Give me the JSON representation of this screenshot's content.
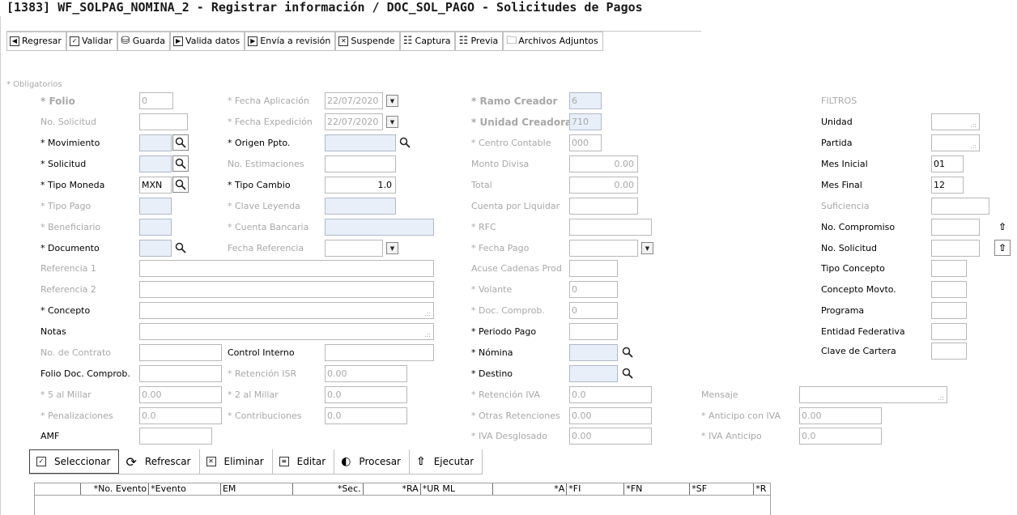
{
  "window": {
    "title": "[1383]  WF_SOLPAG_NOMINA_2 - Registrar información / DOC_SOL_PAGO - Solicitudes de Pagos"
  },
  "toolbar": {
    "items": [
      {
        "label": "Regresar",
        "icon": "back-icon"
      },
      {
        "label": "Validar",
        "icon": "check-icon"
      },
      {
        "label": "Guarda",
        "icon": "save-icon"
      },
      {
        "label": "Valida datos",
        "icon": "play-icon"
      },
      {
        "label": "Envía a revisión",
        "icon": "play-icon"
      },
      {
        "label": "Suspende",
        "icon": "close-icon"
      },
      {
        "label": "Captura",
        "icon": "capture-icon"
      },
      {
        "label": "Previa",
        "icon": "preview-icon"
      },
      {
        "label": "Archivos Adjuntos",
        "icon": "folder-icon"
      }
    ]
  },
  "form": {
    "obligatorios": "* Obligatorios",
    "folio_label": "* Folio",
    "folio_value": "0",
    "no_solicitud_label": "No. Solicitud",
    "movimiento_label": "* Movimiento",
    "solicitud_label": "* Solicitud",
    "tipo_moneda_label": "* Tipo Moneda",
    "tipo_moneda_value": "MXN",
    "tipo_pago_label": "* Tipo Pago",
    "beneficiario_label": "* Beneficiario",
    "documento_label": "* Documento",
    "referencia1_label": "Referencia 1",
    "referencia2_label": "Referencia 2",
    "concepto_label": "* Concepto",
    "notas_label": "Notas",
    "no_contrato_label": "No. de Contrato",
    "folio_doc_label": "Folio Doc. Comprob.",
    "cinco_millar_label": "* 5 al Millar",
    "cinco_millar_value": "0.00",
    "penalizaciones_label": "* Penalizaciones",
    "penalizaciones_value": "0.0",
    "amf_label": "AMF",
    "fecha_aplicacion_label": "* Fecha Aplicación",
    "fecha_aplicacion_value": "22/07/2020",
    "fecha_expedicion_label": "* Fecha Expedición",
    "fecha_expedicion_value": "22/07/2020",
    "origen_ppto_label": "* Origen Ppto.",
    "no_estimaciones_label": "No. Estimaciones",
    "tipo_cambio_label": "* Tipo  Cambio",
    "tipo_cambio_value": "1.0",
    "clave_leyenda_label": "* Clave Leyenda",
    "cuenta_bancaria_label": "* Cuenta Bancaria",
    "fecha_referencia_label": "Fecha Referencia",
    "control_interno_label": "Control Interno",
    "retencion_isr_label": "* Retención ISR",
    "retencion_isr_value": "0.00",
    "dos_millar_label": "* 2 al Millar",
    "dos_millar_value": "0.0",
    "contribuciones_label": "* Contribuciones",
    "contribuciones_value": "0.0",
    "ramo_creador_label": "* Ramo Creador",
    "ramo_creador_value": "6",
    "unidad_creadora_label": "* Unidad Creadora",
    "unidad_creadora_value": "710",
    "centro_contable_label": "* Centro Contable",
    "centro_contable_value": "000",
    "monto_divisa_label": "Monto Divisa",
    "monto_divisa_value": "0.00",
    "total_label": "Total",
    "total_value": "0.00",
    "cuenta_liquidar_label": "Cuenta por Liquidar",
    "rfc_label": "* RFC",
    "fecha_pago_label": "* Fecha  Pago",
    "acuse_label": "Acuse Cadenas Prod",
    "volante_label": "* Volante",
    "volante_value": "0",
    "doc_comprob_label": "* Doc. Comprob.",
    "doc_comprob_value": "0",
    "periodo_pago_label": "* Periodo  Pago",
    "nomina_label": "* Nómina",
    "destino_label": "* Destino",
    "retencion_iva_label": "* Retención IVA",
    "retencion_iva_value": "0.0",
    "otras_retenciones_label": "* Otras Retenciones",
    "otras_retenciones_value": "0.00",
    "iva_desglosado_label": "* IVA Desglosado",
    "iva_desglosado_value": "0.00",
    "mensaje_label": "Mensaje",
    "anticipo_iva_label": "* Anticipo con IVA",
    "anticipo_iva_value": "0.00",
    "iva_anticipo_label": "* IVA Anticipo",
    "iva_anticipo_value": "0.0"
  },
  "filtros": {
    "title": "FILTROS",
    "unidad_label": "Unidad",
    "partida_label": "Partida",
    "mes_inicial_label": "Mes Inicial",
    "mes_inicial_value": "01",
    "mes_final_label": "Mes Final",
    "mes_final_value": "12",
    "suficiencia_label": "Suficiencia",
    "no_compromiso_label": "No. Compromiso",
    "no_solicitud_label": "No. Solicitud",
    "tipo_concepto_label": "Tipo Concepto",
    "concepto_movto_label": "Concepto Movto.",
    "programa_label": "Programa",
    "entidad_federativa_label": "Entidad Federativa",
    "clave_cartera_label": "Clave de Cartera"
  },
  "actions": {
    "seleccionar": "Seleccionar",
    "refrescar": "Refrescar",
    "eliminar": "Eliminar",
    "editar": "Editar",
    "procesar": "Procesar",
    "ejecutar": "Ejecutar"
  },
  "grid": {
    "columns": [
      "*No. Evento",
      "*Evento",
      "EM",
      "*Sec.",
      "*RA",
      "*UR ML",
      "*A",
      "*FI",
      "*FN",
      "*SF",
      "*R"
    ]
  }
}
